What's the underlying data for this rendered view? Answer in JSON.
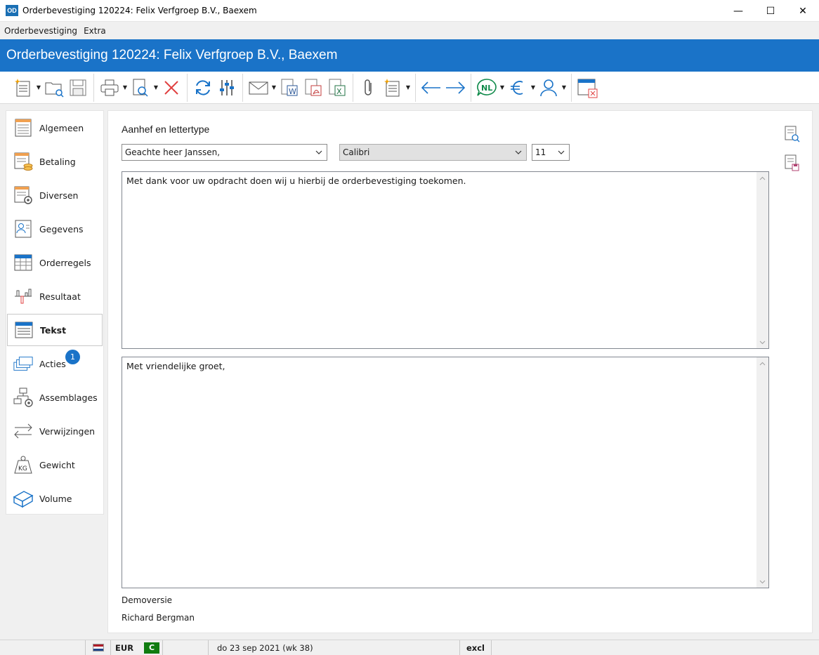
{
  "window": {
    "logo_text": "OD",
    "title": "Orderbevestiging 120224: Felix Verfgroep B.V., Baexem",
    "minimize": "—",
    "maximize": "☐",
    "close": "✕"
  },
  "menu": {
    "items": [
      "Orderbevestiging",
      "Extra"
    ]
  },
  "header": {
    "title": "Orderbevestiging 120224: Felix Verfgroep B.V., Baexem"
  },
  "toolbar": {
    "language_label": "NL"
  },
  "sidebar": {
    "items": [
      {
        "label": "Algemeen",
        "icon": "form-icon"
      },
      {
        "label": "Betaling",
        "icon": "payment-icon"
      },
      {
        "label": "Diversen",
        "icon": "settings-form-icon"
      },
      {
        "label": "Gegevens",
        "icon": "contact-card-icon"
      },
      {
        "label": "Orderregels",
        "icon": "table-icon"
      },
      {
        "label": "Resultaat",
        "icon": "chart-icon"
      },
      {
        "label": "Tekst",
        "icon": "text-icon",
        "active": true
      },
      {
        "label": "Acties",
        "icon": "actions-icon",
        "badge": "1"
      },
      {
        "label": "Assemblages",
        "icon": "assembly-icon"
      },
      {
        "label": "Verwijzingen",
        "icon": "arrows-icon"
      },
      {
        "label": "Gewicht",
        "icon": "weight-icon"
      },
      {
        "label": "Volume",
        "icon": "box-icon"
      }
    ]
  },
  "main": {
    "section_title": "Aanhef en lettertype",
    "salutation": "Geachte heer Janssen,",
    "font": "Calibri",
    "font_size": "11",
    "intro_text": "Met dank voor uw opdracht doen wij u hierbij de orderbevestiging toekomen.",
    "closing_text": "Met vriendelijke groet,",
    "company_line": "Demoversie",
    "signature_line": "Richard Bergman"
  },
  "status": {
    "currency": "EUR",
    "c_badge": "C",
    "date": "do 23 sep 2021 (wk 38)",
    "vat_mode": "excl"
  },
  "colors": {
    "accent_blue": "#1a73c8",
    "status_green": "#107c10",
    "delete_red": "#e04040"
  }
}
